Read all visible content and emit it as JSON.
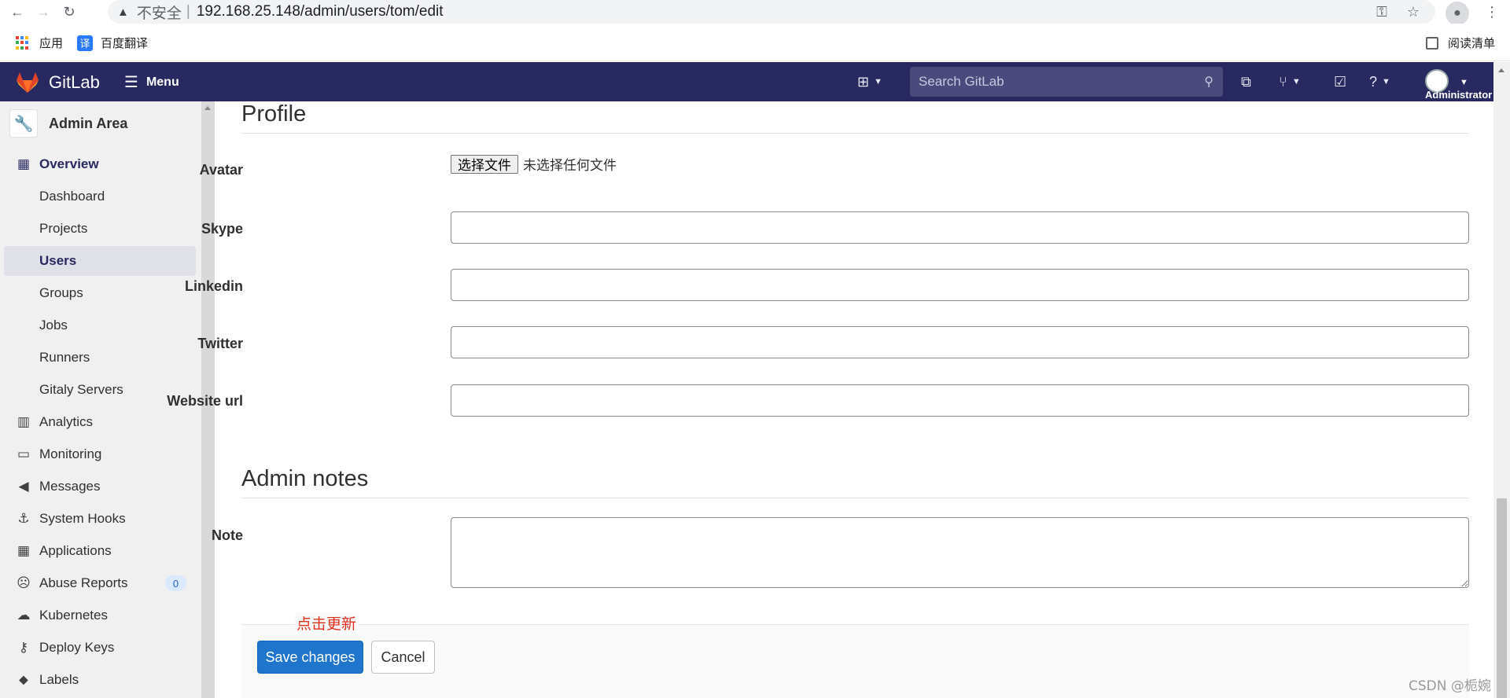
{
  "browser": {
    "back_icon": "arrow-left-icon",
    "forward_icon": "arrow-right-icon",
    "reload_icon": "reload-icon",
    "security_label": "不安全",
    "separator": "|",
    "url": "192.168.25.148/admin/users/tom/edit",
    "bookmarks": [
      {
        "label": "应用",
        "icon": "apps-grid-icon"
      },
      {
        "label": "百度翻译",
        "icon": "baidu-fanyi-icon",
        "icon_glyph": "译"
      }
    ],
    "reading_list": "阅读清单"
  },
  "header": {
    "brand": "GitLab",
    "menu_label": "Menu",
    "search_placeholder": "Search GitLab",
    "user_name": "Administrator"
  },
  "sidebar": {
    "title": "Admin Area",
    "items": [
      {
        "label": "Overview",
        "icon": "overview-grid-icon",
        "glyph": "▦"
      },
      {
        "label": "Dashboard"
      },
      {
        "label": "Projects"
      },
      {
        "label": "Users",
        "active": true
      },
      {
        "label": "Groups"
      },
      {
        "label": "Jobs"
      },
      {
        "label": "Runners"
      },
      {
        "label": "Gitaly Servers"
      },
      {
        "label": "Analytics",
        "icon": "analytics-chart-icon",
        "glyph": "📊"
      },
      {
        "label": "Monitoring",
        "icon": "monitor-icon",
        "glyph": "🖥"
      },
      {
        "label": "Messages",
        "icon": "megaphone-icon",
        "glyph": "📣"
      },
      {
        "label": "System Hooks",
        "icon": "hook-icon",
        "glyph": "⚓"
      },
      {
        "label": "Applications",
        "icon": "applications-icon",
        "glyph": "▦"
      },
      {
        "label": "Abuse Reports",
        "icon": "abuse-face-icon",
        "glyph": "☹",
        "badge": "0"
      },
      {
        "label": "Kubernetes",
        "icon": "kubernetes-cloud-icon",
        "glyph": "☁"
      },
      {
        "label": "Deploy Keys",
        "icon": "key-icon",
        "glyph": "🔑"
      },
      {
        "label": "Labels",
        "icon": "label-tag-icon",
        "glyph": "🏷"
      }
    ]
  },
  "profile": {
    "section_title": "Profile",
    "avatar_label": "Avatar",
    "file_button": "选择文件",
    "file_status": "未选择任何文件",
    "skype_label": "Skype",
    "skype_value": "",
    "linkedin_label": "Linkedin",
    "linkedin_value": "",
    "twitter_label": "Twitter",
    "twitter_value": "",
    "website_label": "Website url",
    "website_value": ""
  },
  "admin_notes": {
    "section_title": "Admin notes",
    "note_label": "Note",
    "note_value": ""
  },
  "actions": {
    "annotation": "点击更新",
    "save_label": "Save changes",
    "cancel_label": "Cancel"
  },
  "watermark": "CSDN @栀婉",
  "colors": {
    "header_bg": "#292961",
    "primary_button": "#1f75cb",
    "annotation_red": "#e0301e",
    "sidebar_bg": "#f0f0f0"
  }
}
